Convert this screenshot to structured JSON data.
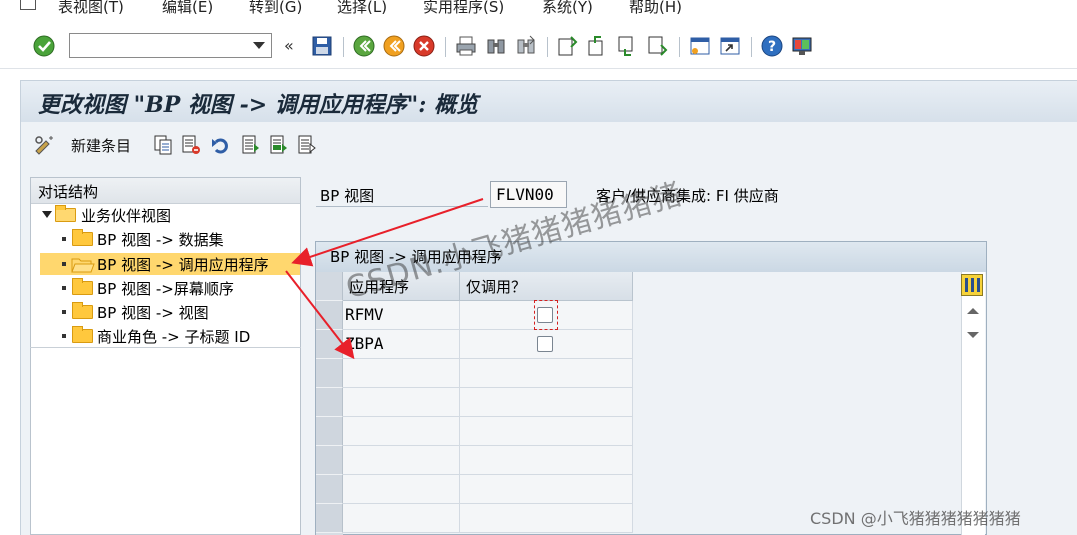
{
  "menu": {
    "items": [
      "表视图(T)",
      "编辑(E)",
      "转到(G)",
      "选择(L)",
      "实用程序(S)",
      "系统(Y)",
      "帮助(H)"
    ]
  },
  "toolbar": {
    "command_field_value": "",
    "icons": [
      "enter-check-icon",
      "collapse-icon",
      "save-icon",
      "back-icon",
      "exit-icon",
      "cancel-icon",
      "print-icon",
      "find-icon",
      "find-next-icon",
      "first-page-icon",
      "previous-page-icon",
      "next-page-icon",
      "last-page-icon",
      "create-session-icon",
      "shortcut-icon",
      "help-icon",
      "layout-icon"
    ]
  },
  "title": "更改视图 \"BP 视图 -> 调用应用程序\": 概览",
  "app_toolbar": {
    "new_entries_label": "新建条目"
  },
  "tree": {
    "header": "对话结构",
    "root": "业务伙伴视图",
    "children": [
      "BP 视图 -> 数据集",
      "BP 视图 -> 调用应用程序",
      "BP 视图 ->屏幕顺序",
      "BP 视图 -> 视图",
      "商业角色 -> 子标题 ID"
    ],
    "selected_index": 1
  },
  "header_field": {
    "label": "BP 视图",
    "value": "FLVN00",
    "description": "客户/供应商集成: FI 供应商"
  },
  "table": {
    "title": "BP 视图 -> 调用应用程序",
    "columns": [
      "应用程序",
      "仅调用？"
    ],
    "rows": [
      {
        "app": "RFMV",
        "only_call": false
      },
      {
        "app": "ZBPA",
        "only_call": false
      }
    ]
  },
  "overlay": {
    "watermark": "CSDN.小飞猪猪猪猪猪猪",
    "credit": "CSDN @小飞猪猪猪猪猪猪猪",
    "arrow_color": "#e8202a"
  }
}
